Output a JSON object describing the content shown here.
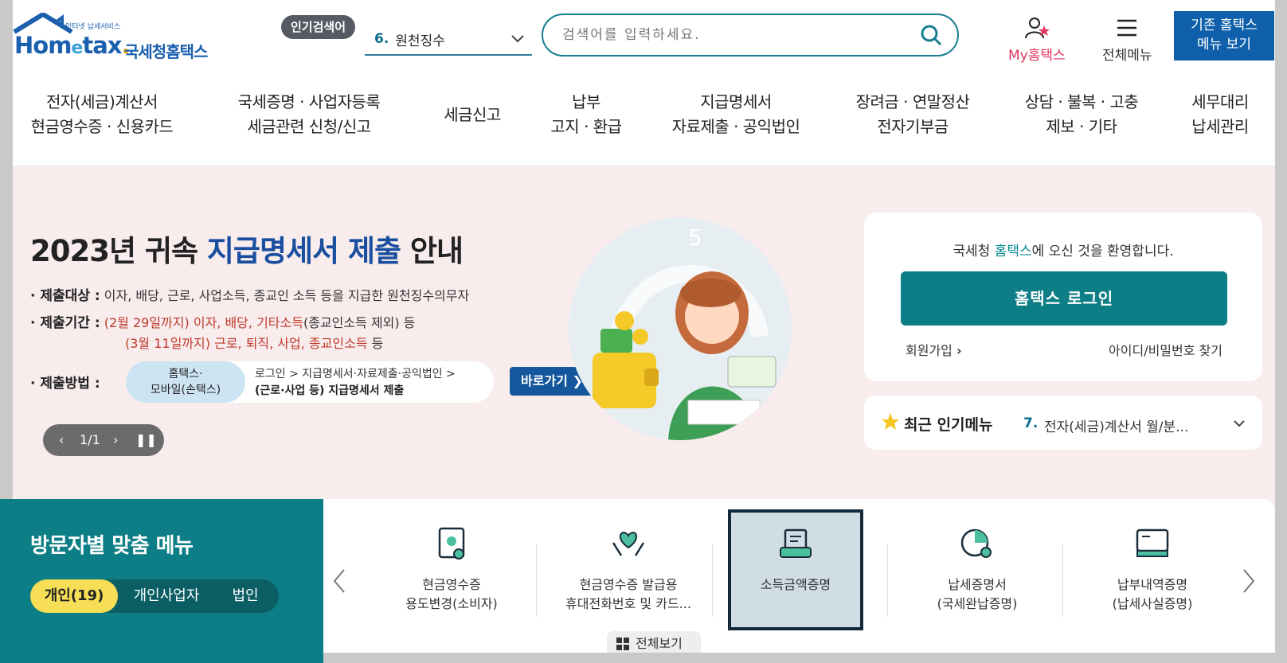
{
  "header": {
    "logo_small": "인터넷 납세서비스",
    "logo_en_1": "Hom",
    "logo_en_e": "e",
    "logo_en_2": "tax",
    "logo_kr": "국세청홈택스",
    "popular_badge": "인기검색어",
    "popular_num": "6.",
    "popular_term": "원천징수",
    "search_placeholder": "검색어를 입력하세요.",
    "my_hometax": "My홈택스",
    "all_menu": "전체메뉴",
    "old_menu_line1": "기존 홈택스",
    "old_menu_line2": "메뉴 보기"
  },
  "gnb": [
    {
      "l1": "전자(세금)계산서",
      "l2": "현금영수증 · 신용카드"
    },
    {
      "l1": "국세증명 · 사업자등록",
      "l2": "세금관련 신청/신고"
    },
    {
      "l1": "세금신고",
      "l2": ""
    },
    {
      "l1": "납부",
      "l2": "고지 · 환급"
    },
    {
      "l1": "지급명세서",
      "l2": "자료제출 · 공익법인"
    },
    {
      "l1": "장려금 · 연말정산",
      "l2": "전자기부금"
    },
    {
      "l1": "상담 · 불복 · 고충",
      "l2": "제보 · 기타"
    },
    {
      "l1": "세무대리",
      "l2": "납세관리"
    }
  ],
  "banner": {
    "title_a": "2023년 귀속 ",
    "title_hl": "지급명세서 제출",
    "title_b": " 안내",
    "target_label": "· 제출대상 :",
    "target_text": "이자, 배당, 근로, 사업소득, 종교인 소득 등을 지급한 원천징수의무자",
    "period_label": "· 제출기간 :",
    "period1_date": "(2월 29일까지)",
    "period1_items": "이자, 배당, 기타소득",
    "period1_note": "(종교인소득 제외) 등",
    "period2_date": "(3월 11일까지)",
    "period2_items": "근로, 퇴직, 사업, 종교인소득",
    "period2_note": " 등",
    "method_label": "· 제출방법 :",
    "method_pill_1": "홈택스·",
    "method_pill_2": "모바일(손택스)",
    "method_path_1": "로그인 > 지급명세서·자료제출·공익법인 >",
    "method_path_2": "(근로·사업 등) 지급명세서 제출",
    "goto": "바로가기",
    "pager": "1/1"
  },
  "login": {
    "welcome_a": "국세청 ",
    "welcome_teal": "홈택스",
    "welcome_b": "에 오신 것을 환영합니다.",
    "login_btn": "홈택스 로그인",
    "join": "회원가입",
    "find": "아이디/비밀번호 찾기"
  },
  "recent": {
    "label": "최근 인기메뉴",
    "num": "7.",
    "value": "전자(세금)계산서 월/분..."
  },
  "visitor": {
    "title": "방문자별 맞춤 메뉴",
    "tabs": [
      "개인(19)",
      "개인사업자",
      "법인"
    ]
  },
  "services": [
    {
      "l1": "현금영수증",
      "l2": "용도변경(소비자)"
    },
    {
      "l1": "현금영수증 발급용",
      "l2": "휴대전화번호 및 카드..."
    },
    {
      "l1": "소득금액증명",
      "l2": ""
    },
    {
      "l1": "납세증명서",
      "l2": "(국세완납증명)"
    },
    {
      "l1": "납부내역증명",
      "l2": "(납세사실증명)"
    }
  ],
  "all_view": "전체보기",
  "colors": {
    "teal": "#0d7e85",
    "blue": "#1a4fa0",
    "pink_bg": "#f8eced",
    "accent_red": "#c0392b",
    "yellow": "#f6df57"
  }
}
